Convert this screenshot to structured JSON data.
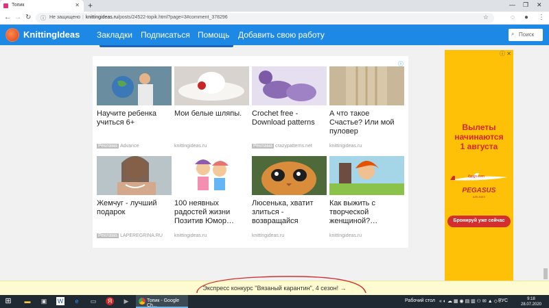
{
  "browser": {
    "tab_title": "Топик",
    "new_tab": "+",
    "security": "Не защищено",
    "url_host": "knittingideas.ru",
    "url_path": "/posts/24522-topik.html?page=3#comment_378296"
  },
  "site": {
    "logo": "KnittingIdeas",
    "nav": [
      "Закладки",
      "Подписаться",
      "Помощь",
      "Добавить свою работу"
    ],
    "search_placeholder": "Поиск"
  },
  "ads": [
    {
      "title": "Научите ребенка учиться 6+",
      "tag": "Реклама",
      "source": "Advance",
      "art": "kid-globe"
    },
    {
      "title": "Мои белые шляпы.",
      "tag": "",
      "source": "knittingideas.ru",
      "art": "white-hat"
    },
    {
      "title": "Crochet free - Download patterns",
      "tag": "Реклама",
      "source": "crazypatterns.net",
      "art": "booties"
    },
    {
      "title": "А что такое Счастье? Или мой пуловер",
      "tag": "",
      "source": "knittingideas.ru",
      "art": "sweater"
    },
    {
      "title": "Жемчуг - лучший подарок",
      "tag": "Реклама",
      "source": "LAPEREGRINA.RU",
      "art": "pearls"
    },
    {
      "title": "100 неявных радостей жизни Позитив Юмор…",
      "tag": "",
      "source": "knittingideas.ru",
      "art": "cartoon"
    },
    {
      "title": "Люсенька, хватит злиться - возвращайся",
      "tag": "",
      "source": "knittingideas.ru",
      "art": "cat"
    },
    {
      "title": "Как выжить с творческой женщиной?…",
      "tag": "",
      "source": "knittingideas.ru",
      "art": "redhead"
    }
  ],
  "banner": {
    "headline_1": "Вылеты",
    "headline_2": "начинаются",
    "headline_3": "1 августа",
    "plane_text": "flypgs.com",
    "brand": "PEGASUS",
    "brand_sub": "AIRLINES",
    "cta": "Бронируй уже сейчас"
  },
  "contest_bar": "Экспресс конкурс \"Вязаный карантин\", 4 сезон! →",
  "taskbar": {
    "active_window": "Топик - Google Ch...",
    "desktop_label": "Рабочий стол",
    "lang": "РУС",
    "time": "9:18",
    "date": "28.07.2020"
  },
  "colors": {
    "header_blue": "#1e88e5",
    "banner_yellow": "#ffc107",
    "banner_red": "#d62828"
  }
}
